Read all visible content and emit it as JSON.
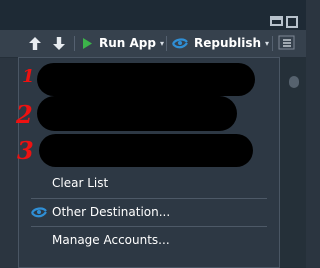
{
  "toolbar": {
    "run_app_label": "Run App",
    "republish_label": "Republish",
    "run_caret": "▾",
    "republish_caret": "▾"
  },
  "menu": {
    "recent_markers": [
      "1",
      "2",
      "3"
    ],
    "clear_list_label": "Clear List",
    "other_destination_label": "Other Destination...",
    "manage_accounts_label": "Manage Accounts..."
  },
  "colors": {
    "run_green": "#3cb44a",
    "publish_blue": "#2f8fd6",
    "annotation_red": "#ee1111",
    "redaction": "#000000"
  }
}
